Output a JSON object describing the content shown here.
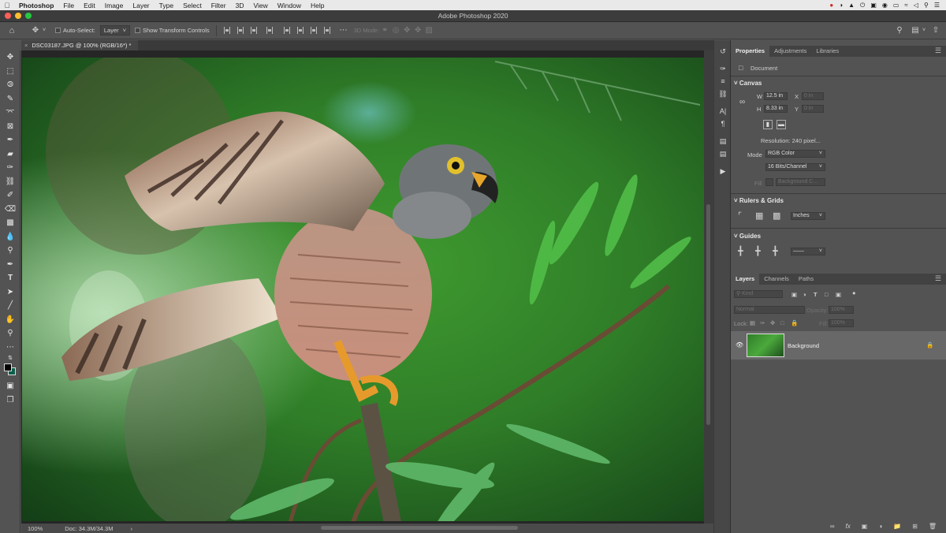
{
  "menubar": {
    "app": "Photoshop",
    "items": [
      "File",
      "Edit",
      "Image",
      "Layer",
      "Type",
      "Select",
      "Filter",
      "3D",
      "View",
      "Window",
      "Help"
    ]
  },
  "window": {
    "title": "Adobe Photoshop 2020",
    "document_tab": "DSC03187.JPG @ 100% (RGB/16*) *"
  },
  "options": {
    "auto_select_label": "Auto-Select:",
    "auto_select_target": "Layer",
    "transform_controls_label": "Show Transform Controls",
    "mode_3d_label": "3D Mode:"
  },
  "tools": [
    "move",
    "marquee",
    "lasso",
    "quick-select",
    "crop",
    "frame",
    "eyedropper",
    "healing",
    "brush",
    "stamp",
    "history-brush",
    "eraser",
    "gradient",
    "blur",
    "dodge",
    "pen",
    "type",
    "path-select",
    "line",
    "hand",
    "zoom",
    "more"
  ],
  "status": {
    "zoom": "100%",
    "doc": "Doc: 34.3M/34.3M"
  },
  "properties": {
    "tabs": [
      "Properties",
      "Adjustments",
      "Libraries"
    ],
    "doc_label": "Document",
    "canvas_title": "Canvas",
    "w_label": "W",
    "w_value": "12.5 in",
    "h_label": "H",
    "h_value": "8.33 in",
    "x_label": "X",
    "x_value": "0 in",
    "y_label": "Y",
    "y_value": "0 in",
    "resolution": "Resolution: 240 pixel...",
    "mode_label": "Mode",
    "mode_value": "RGB Color",
    "depth_value": "16 Bits/Channel",
    "fill_label": "Fill",
    "fill_value": "Background C...",
    "rulers_title": "Rulers & Grids",
    "units_value": "Inches",
    "guides_title": "Guides"
  },
  "layers": {
    "tabs": [
      "Layers",
      "Channels",
      "Paths"
    ],
    "kind_placeholder": "Kind",
    "blend_mode": "Normal",
    "opacity_label": "Opacity:",
    "opacity_value": "100%",
    "lock_label": "Lock:",
    "fill_label": "Fill:",
    "fill_value": "100%",
    "items": [
      {
        "name": "Background",
        "visible": true,
        "locked": true
      }
    ]
  },
  "colors": {
    "accent_close": "#fe5f57",
    "accent_min": "#febc2e",
    "accent_max": "#28c840"
  }
}
